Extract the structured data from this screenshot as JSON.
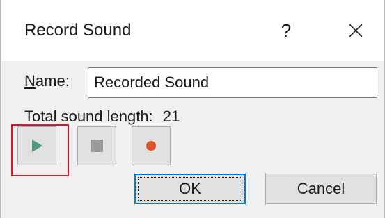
{
  "window": {
    "title": "Record Sound",
    "help_glyph": "?",
    "close_icon": "close-icon"
  },
  "form": {
    "name_label_underlined": "N",
    "name_label_rest": "ame:",
    "name_value": "Recorded Sound",
    "length_label": "Total sound length:",
    "length_value": "21"
  },
  "controls": {
    "play_icon": "play-icon",
    "stop_icon": "stop-icon",
    "record_icon": "record-icon",
    "highlight_color": "#e81123",
    "play_color": "#4e9a7a",
    "stop_color": "#9a9a9a",
    "record_color": "#d9542c"
  },
  "buttons": {
    "ok_label": "OK",
    "cancel_label": "Cancel"
  }
}
